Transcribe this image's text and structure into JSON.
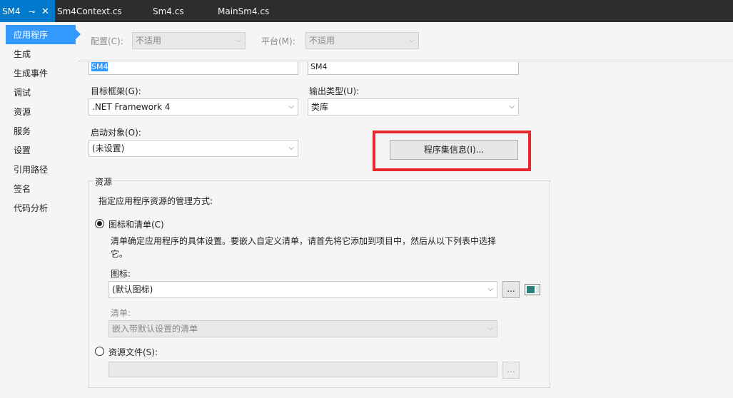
{
  "tabs": [
    {
      "label": "SM4",
      "active": true
    },
    {
      "label": "Sm4Context.cs"
    },
    {
      "label": "Sm4.cs"
    },
    {
      "label": "MainSm4.cs"
    }
  ],
  "tab_icons": {
    "pin": "⊸",
    "close": "✕"
  },
  "nav": {
    "items": [
      "应用程序",
      "生成",
      "生成事件",
      "调试",
      "资源",
      "服务",
      "设置",
      "引用路径",
      "签名",
      "代码分析"
    ],
    "selected_index": 0
  },
  "config": {
    "configuration_label": "配置(C):",
    "configuration_value": "不适用",
    "platform_label": "平台(M):",
    "platform_value": "不适用"
  },
  "app": {
    "assembly_name": "SM4",
    "default_namespace": "SM4",
    "target_framework_label": "目标框架(G):",
    "target_framework_value": ".NET Framework 4",
    "output_type_label": "输出类型(U):",
    "output_type_value": "类库",
    "startup_object_label": "启动对象(O):",
    "startup_object_value": "(未设置)",
    "assembly_info_button": "程序集信息(I)..."
  },
  "resources": {
    "group_title": "资源",
    "description": "指定应用程序资源的管理方式:",
    "icon_manifest_radio": "图标和清单(C)",
    "icon_manifest_checked": true,
    "manifest_help_line1": "清单确定应用程序的具体设置。要嵌入自定义清单，请首先将它添加到项目中，然后从以下列表中选择",
    "manifest_help_line2": "它。",
    "icon_label": "图标:",
    "icon_value": "(默认图标)",
    "browse_button": "...",
    "manifest_label": "清单:",
    "manifest_value": "嵌入带默认设置的清单",
    "resource_file_radio": "资源文件(S):",
    "resource_file_checked": false,
    "resource_file_value": ""
  },
  "colors": {
    "accent": "#007acc",
    "nav_selected": "#3399ff",
    "highlight_box": "#e8272e"
  }
}
